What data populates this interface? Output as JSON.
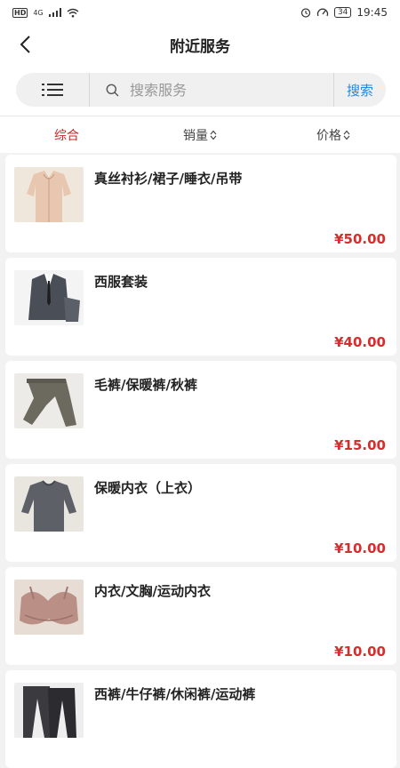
{
  "status_bar": {
    "hd": "HD",
    "network": "4G",
    "battery": "34",
    "time": "19:45"
  },
  "header": {
    "title": "附近服务"
  },
  "search": {
    "placeholder": "搜索服务",
    "button_label": "搜索"
  },
  "sort_tabs": [
    {
      "label": "综合",
      "active": true
    },
    {
      "label": "销量",
      "active": false
    },
    {
      "label": "价格",
      "active": false
    }
  ],
  "accent_color": "#c62828",
  "price_color": "#d32f2f",
  "link_color": "#1e88e5",
  "services": [
    {
      "title": "真丝衬衫/裙子/睡衣/吊带",
      "price": "¥50.00",
      "image": "silk-blouse-photo"
    },
    {
      "title": "西服套装",
      "price": "¥40.00",
      "image": "suit-photo"
    },
    {
      "title": "毛裤/保暖裤/秋裤",
      "price": "¥15.00",
      "image": "thermal-pants-photo"
    },
    {
      "title": "保暖内衣（上衣）",
      "price": "¥10.00",
      "image": "thermal-top-photo"
    },
    {
      "title": "内衣/文胸/运动内衣",
      "price": "¥10.00",
      "image": "bra-photo"
    },
    {
      "title": "西裤/牛仔裤/休闲裤/运动裤",
      "price": "",
      "image": "trousers-photo"
    }
  ]
}
